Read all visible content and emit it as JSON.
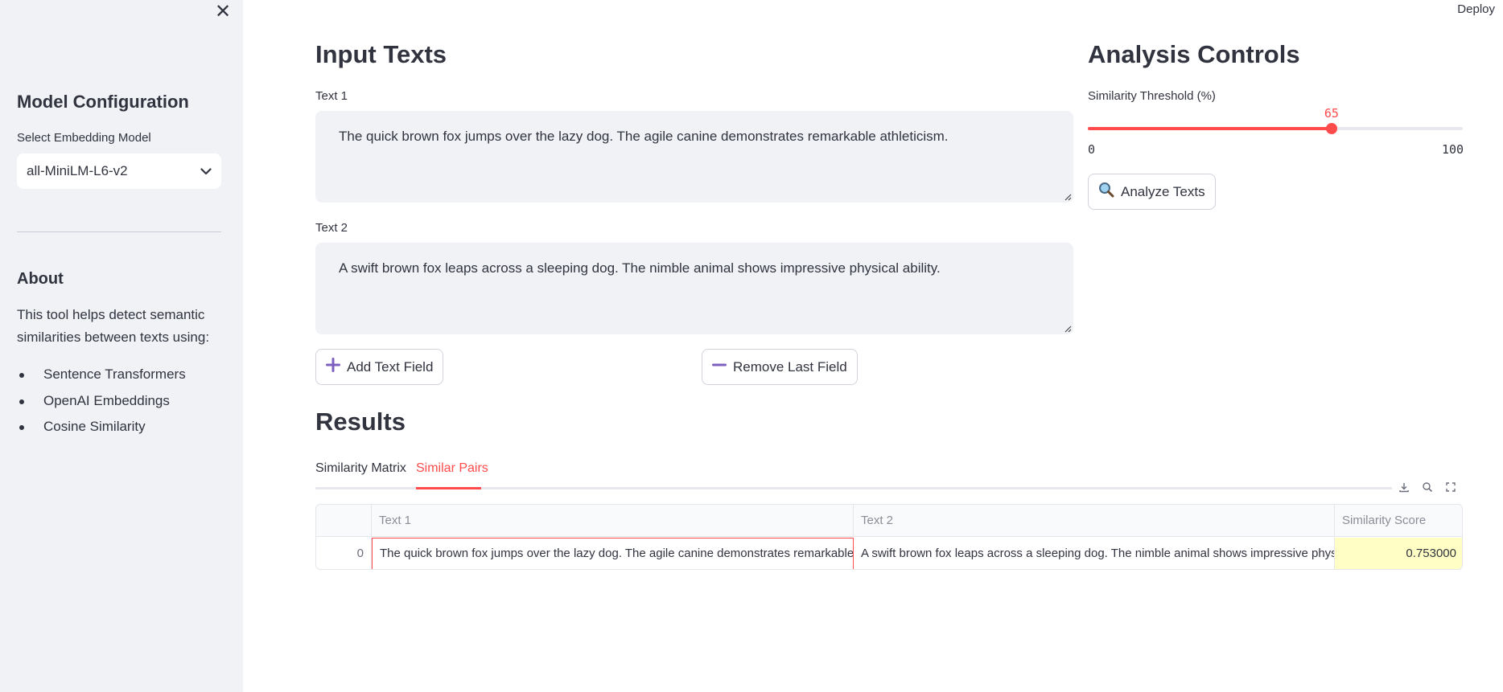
{
  "header": {
    "deploy_label": "Deploy"
  },
  "sidebar": {
    "close_glyph": "✕",
    "model_heading": "Model Configuration",
    "select_label": "Select Embedding Model",
    "select_value": "all-MiniLM-L6-v2",
    "about_heading": "About",
    "about_text": "This tool helps detect semantic similarities between texts using:",
    "about_items": [
      "Sentence Transformers",
      "OpenAI Embeddings",
      "Cosine Similarity"
    ]
  },
  "inputs": {
    "heading": "Input Texts",
    "fields": [
      {
        "label": "Text 1",
        "value": "The quick brown fox jumps over the lazy dog. The agile canine demonstrates remarkable athleticism."
      },
      {
        "label": "Text 2",
        "value": "A swift brown fox leaps across a sleeping dog. The nimble animal shows impressive physical ability."
      }
    ],
    "add_label": "Add Text Field",
    "remove_label": "Remove Last Field"
  },
  "controls": {
    "heading": "Analysis Controls",
    "slider_label": "Similarity Threshold (%)",
    "slider_value": 65,
    "slider_min": 0,
    "slider_max": 100,
    "analyze_label": "Analyze Texts"
  },
  "results": {
    "heading": "Results",
    "tabs": [
      "Similarity Matrix",
      "Similar Pairs"
    ],
    "active_tab": 1,
    "columns": [
      "Text 1",
      "Text 2",
      "Similarity Score"
    ],
    "rows": [
      {
        "index": "0",
        "text1": "The quick brown fox jumps over the lazy dog. The agile canine demonstrates remarkable athleticism.",
        "text2": "A swift brown fox leaps across a sleeping dog. The nimble animal shows impressive physical ability.",
        "score": "0.753000"
      }
    ]
  },
  "colors": {
    "accent": "#ff4b4b",
    "sidebar_bg": "#f0f2f6",
    "plus_minus_icon": "#7d5fbf",
    "score_highlight": "#ffffc5"
  }
}
